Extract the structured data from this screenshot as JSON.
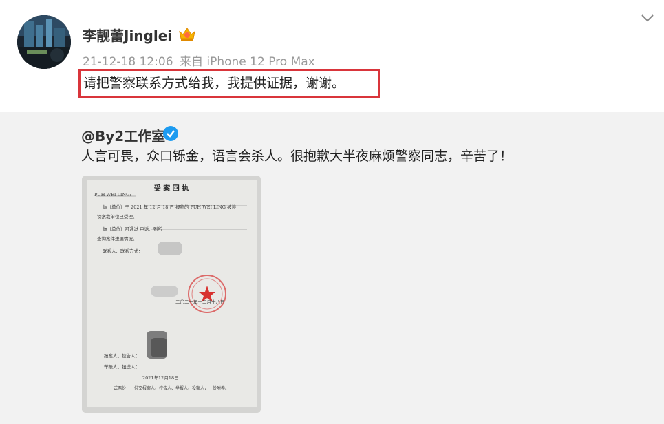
{
  "post": {
    "username": "李靓蕾Jinglei",
    "timestamp": "21-12-18 12:06",
    "source": "来自 iPhone 12 Pro Max",
    "text": "请把警察联系方式给我，我提供证据，谢谢。",
    "highlight_color": "#d9353b"
  },
  "repost": {
    "username": "@By2工作室",
    "text": "人言可畏，众口铄金，语言会杀人。很抱歉大半夜麻烦警察同志，辛苦了！",
    "verified_color": "#1d9bf0",
    "image": {
      "title": "受 案 回 执",
      "addressee": "PUH WEI LING:",
      "line1": "你（单位）于 2021 年 12 月 18 日 报称的 PUH WEI LING 被诽",
      "line2": "谤案我单位已受理。",
      "line3": "你（单位）可通过      电话、到所",
      "line4": "查询案件进展情况。",
      "line5": "联系人、联系方式：",
      "line6": "二〇二一年十二月十八日",
      "line7": "报案人、控告人：",
      "line8": "举报人、扭送人：",
      "line9": "2021年12月18日",
      "line10": "一式两份，一份交报案人、控告人、举报人、投案人，一份附卷。"
    }
  },
  "icons": {
    "chevron": "chevron-down-icon",
    "vip": "vip-crown-icon",
    "verified": "verified-check-icon"
  }
}
